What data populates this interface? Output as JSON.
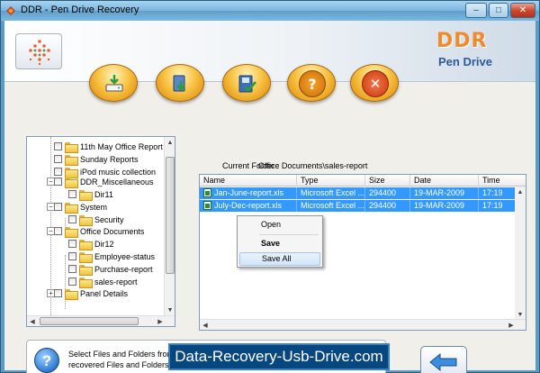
{
  "window": {
    "title": "DDR - Pen Drive Recovery",
    "buttons": {
      "minimize": "–",
      "maximize": "□",
      "close": "✕"
    }
  },
  "header": {
    "brand_title": "DDR",
    "brand_subtitle": "Pen Drive",
    "toolbar": [
      {
        "name": "drive-icon"
      },
      {
        "name": "recover-icon"
      },
      {
        "name": "save-check-icon"
      },
      {
        "name": "help-icon"
      },
      {
        "name": "exit-icon"
      }
    ]
  },
  "tree": {
    "items": [
      {
        "label": "11th May Office Report"
      },
      {
        "label": "Sunday Reports"
      },
      {
        "label": "iPod music collection"
      },
      {
        "label": "DDR_Miscellaneous"
      },
      {
        "label": "Dir11"
      },
      {
        "label": "System"
      },
      {
        "label": "Security"
      },
      {
        "label": "Office Documents"
      },
      {
        "label": "Dir12"
      },
      {
        "label": "Employee-status"
      },
      {
        "label": "Purchase-report"
      },
      {
        "label": "sales-report"
      },
      {
        "label": "Panel Details"
      }
    ]
  },
  "current_folder": {
    "label": "Current Folder :",
    "value": "Office Documents\\sales-report"
  },
  "grid": {
    "columns": [
      "Name",
      "Type",
      "Size",
      "Date",
      "Time"
    ],
    "rows": [
      {
        "name": "Jan-June-report.xls",
        "type": "Microsoft Excel ...",
        "size": "294400",
        "date": "19-MAR-2009",
        "time": "17:19"
      },
      {
        "name": "July-Dec-report.xls",
        "type": "Microsoft Excel ...",
        "size": "294400",
        "date": "19-MAR-2009",
        "time": "17:19"
      }
    ]
  },
  "context_menu": {
    "open": "Open",
    "save": "Save",
    "save_all": "Save All"
  },
  "hint": {
    "line1": "Select Files and Folders from left",
    "line2": "recovered Files and Folders."
  },
  "url_banner": "Data-Recovery-Usb-Drive.com",
  "colors": {
    "brand_orange": "#f08a2b",
    "brand_blue": "#2c5a9a",
    "selection": "#3399ff",
    "banner": "#06477f"
  }
}
